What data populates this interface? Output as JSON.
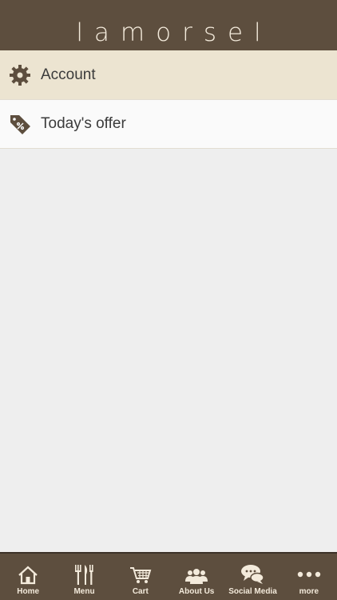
{
  "header": {
    "title": "lamorsel"
  },
  "menu": [
    {
      "label": "Account",
      "icon": "gear-icon"
    },
    {
      "label": "Today's offer",
      "icon": "price-tag-icon"
    }
  ],
  "tabs": [
    {
      "label": "Home",
      "icon": "home-icon"
    },
    {
      "label": "Menu",
      "icon": "utensils-icon"
    },
    {
      "label": "Cart",
      "icon": "cart-icon"
    },
    {
      "label": "About Us",
      "icon": "people-icon"
    },
    {
      "label": "Social Media",
      "icon": "chat-bubbles-icon"
    },
    {
      "label": "more",
      "icon": "more-dots-icon"
    }
  ],
  "colors": {
    "brand": "#5d4e3e",
    "highlight": "#ece4d1",
    "text_light": "#f3eadb"
  }
}
